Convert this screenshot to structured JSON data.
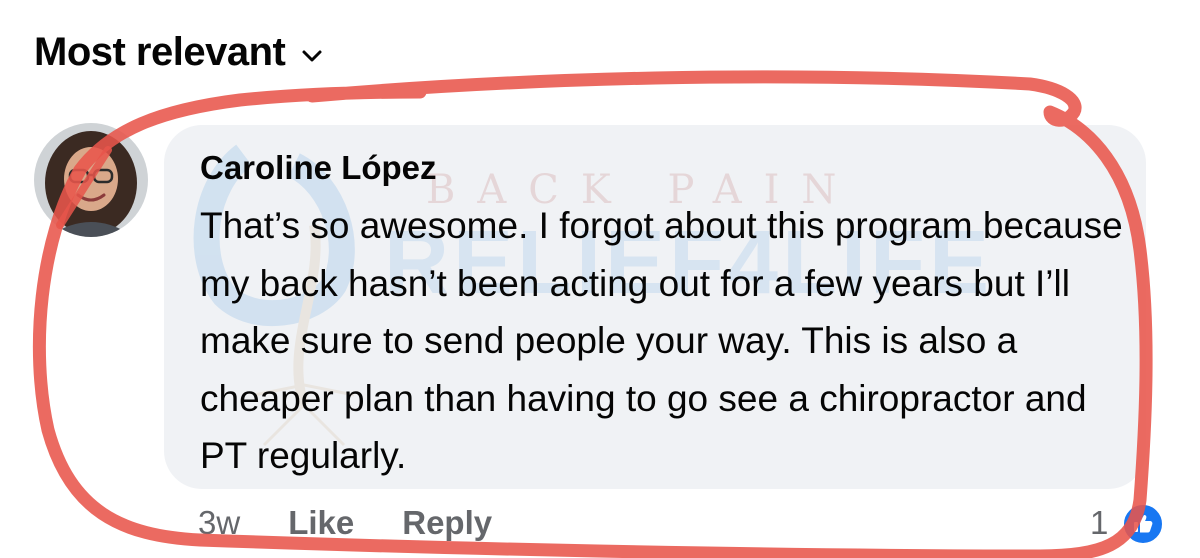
{
  "sort": {
    "label": "Most relevant",
    "icon": "chevron-down-icon"
  },
  "comment": {
    "author": "Caroline López",
    "text": "That’s so awesome. I forgot about this program because my back hasn’t been acting out for a few years but I’ll make sure to send people your way. This is also a cheaper plan than having to go see a chiropractor and PT regularly.",
    "time": "3w",
    "like_label": "Like",
    "reply_label": "Reply",
    "reaction_count": "1",
    "reaction_icon": "thumbs-up-icon"
  },
  "watermark": {
    "top_text": "BACK PAIN",
    "main_text": "RELIEF4LIFE"
  },
  "colors": {
    "bubble": "#f0f2f5",
    "meta": "#65676b",
    "like_blue": "#1877f2",
    "annotation_red": "#e8554b"
  }
}
